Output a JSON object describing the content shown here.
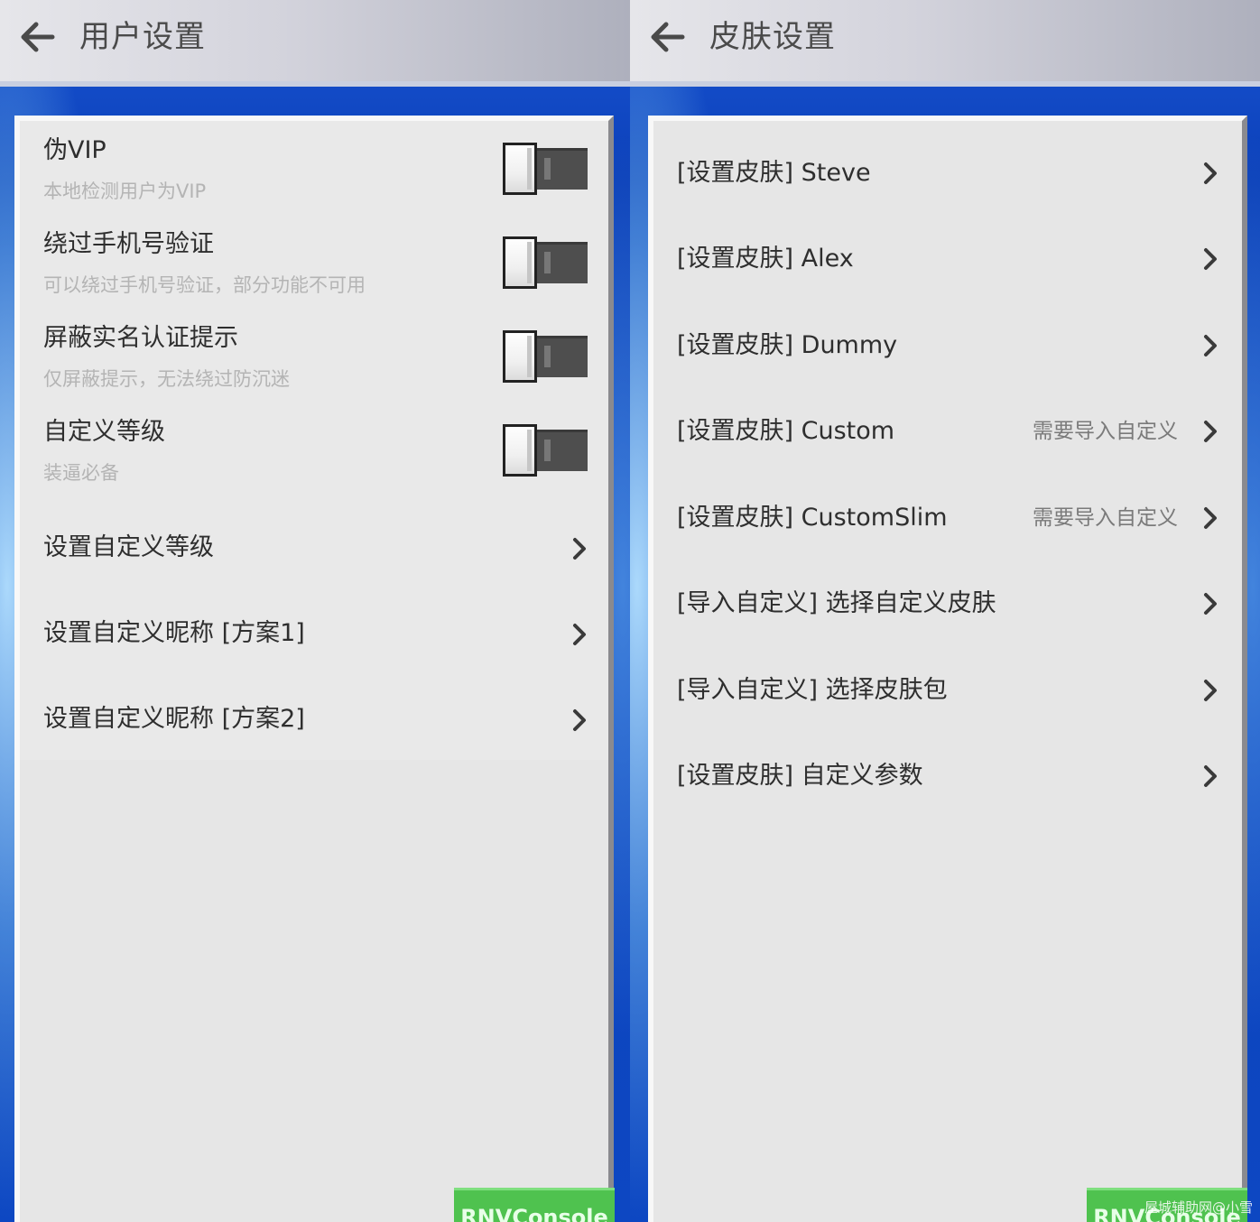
{
  "left_screen": {
    "title": "用户设置",
    "toggles": [
      {
        "title": "伪VIP",
        "subtitle": "本地检测用户为VIP",
        "on": false
      },
      {
        "title": "绕过手机号验证",
        "subtitle": "可以绕过手机号验证，部分功能不可用",
        "on": false
      },
      {
        "title": "屏蔽实名认证提示",
        "subtitle": "仅屏蔽提示，无法绕过防沉迷",
        "on": false
      },
      {
        "title": "自定义等级",
        "subtitle": "装逼必备",
        "on": false
      }
    ],
    "links": [
      {
        "title": "设置自定义等级"
      },
      {
        "title": "设置自定义昵称 [方案1]"
      },
      {
        "title": "设置自定义昵称 [方案2]"
      }
    ],
    "console_button": "RNVConsole"
  },
  "right_screen": {
    "title": "皮肤设置",
    "items": [
      {
        "title": "[设置皮肤] Steve",
        "hint": ""
      },
      {
        "title": "[设置皮肤] Alex",
        "hint": ""
      },
      {
        "title": "[设置皮肤] Dummy",
        "hint": ""
      },
      {
        "title": "[设置皮肤] Custom",
        "hint": "需要导入自定义"
      },
      {
        "title": "[设置皮肤] CustomSlim",
        "hint": "需要导入自定义"
      },
      {
        "title": "[导入自定义] 选择自定义皮肤",
        "hint": ""
      },
      {
        "title": "[导入自定义] 选择皮肤包",
        "hint": ""
      },
      {
        "title": "[设置皮肤] 自定义参数",
        "hint": ""
      }
    ],
    "console_button": "RNVConsole"
  },
  "watermark": "屋城辅助网@小雪",
  "icons": {
    "back": "arrow-left-icon",
    "chevron": "chevron-right-icon"
  },
  "colors": {
    "panel_bg": "#e6e6e6",
    "list_bg": "#e9e9e9",
    "title_text": "#2e2e2e",
    "subtitle_text": "#b4b4b4",
    "console_green": "#4fc24f",
    "background_blue": "#0b3fb8"
  }
}
